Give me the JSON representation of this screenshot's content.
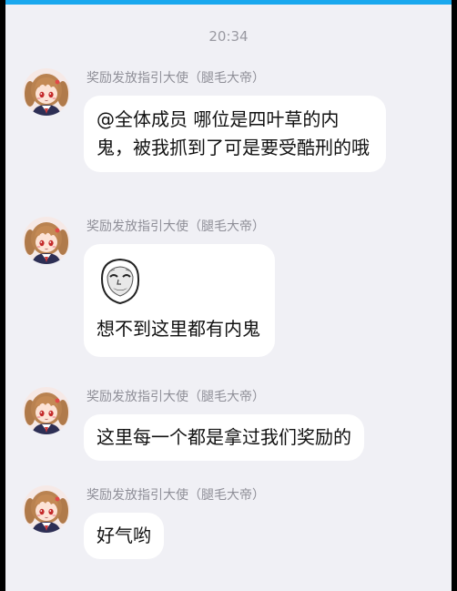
{
  "chat": {
    "timestamp": "20:34",
    "messages": [
      {
        "sender": "奖励发放指引大使（腿毛大帝）",
        "avatar_icon": "anime-girl-avatar-icon",
        "text": "@全体成员 哪位是四叶草的内鬼，被我抓到了可是要受酷刑的哦"
      },
      {
        "sender": "奖励发放指引大使（腿毛大帝）",
        "avatar_icon": "anime-girl-avatar-icon",
        "sticker_icon": "panda-man-meme-icon",
        "text": "想不到这里都有内鬼"
      },
      {
        "sender": "奖励发放指引大使（腿毛大帝）",
        "avatar_icon": "anime-girl-avatar-icon",
        "text": "这里每一个都是拿过我们奖励的"
      },
      {
        "sender": "奖励发放指引大使（腿毛大帝）",
        "avatar_icon": "anime-girl-avatar-icon",
        "text": "好气哟"
      }
    ]
  },
  "colors": {
    "background": "#f0f0f5",
    "bubble": "#ffffff",
    "accent_bar": "#1aa8ee",
    "meta_text": "#8f8f98"
  }
}
